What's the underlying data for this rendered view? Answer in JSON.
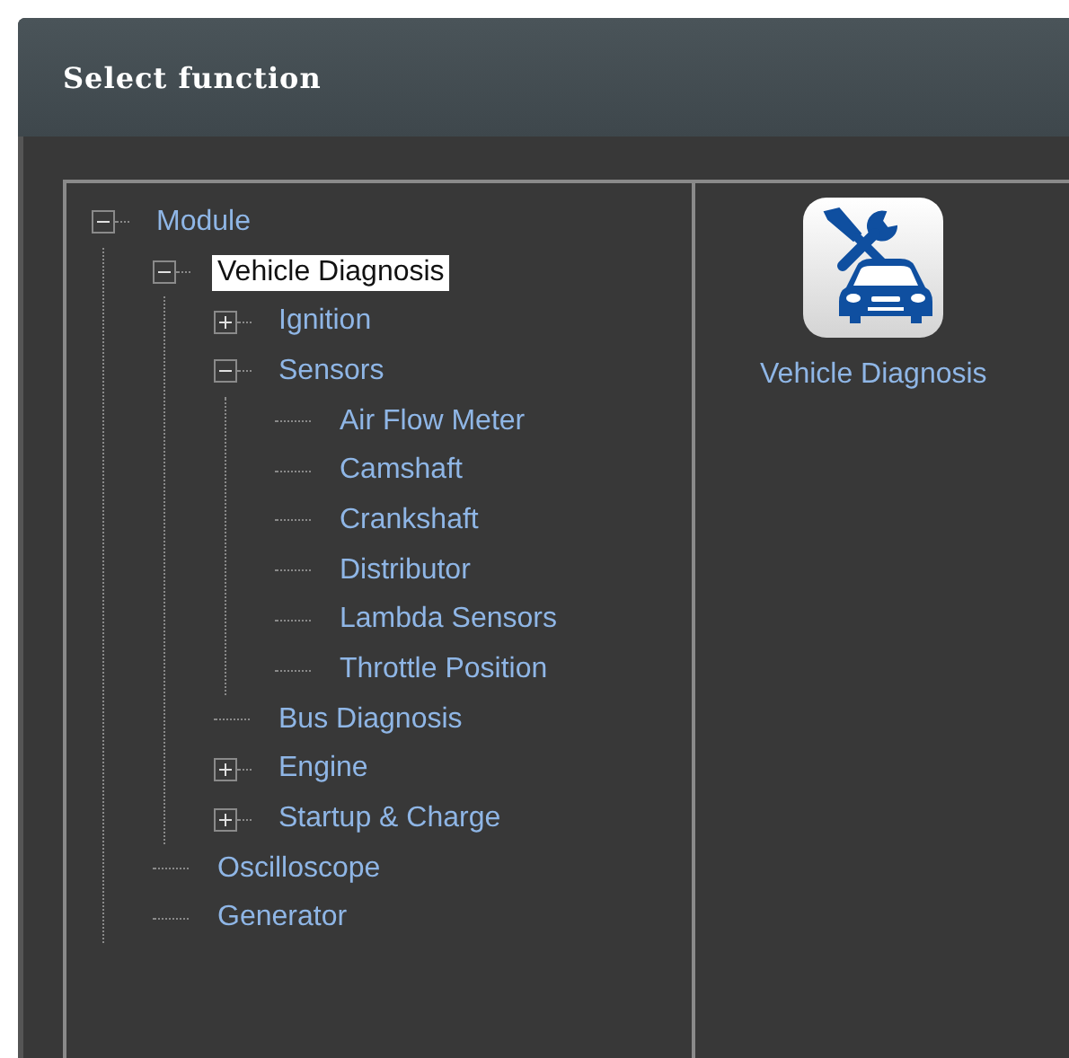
{
  "window": {
    "title": "Select function"
  },
  "tree": [
    {
      "label": "Module",
      "expanded": true,
      "selected": false,
      "children": [
        {
          "label": "Vehicle Diagnosis",
          "expanded": true,
          "selected": true,
          "children": [
            {
              "label": "Ignition",
              "expanded": false,
              "selected": false
            },
            {
              "label": "Sensors",
              "expanded": true,
              "selected": false,
              "children": [
                {
                  "label": "Air Flow Meter",
                  "selected": false
                },
                {
                  "label": "Camshaft",
                  "selected": false
                },
                {
                  "label": "Crankshaft",
                  "selected": false
                },
                {
                  "label": "Distributor",
                  "selected": false
                },
                {
                  "label": "Lambda Sensors",
                  "selected": false
                },
                {
                  "label": "Throttle Position",
                  "selected": false
                }
              ]
            },
            {
              "label": "Bus Diagnosis",
              "selected": false
            },
            {
              "label": "Engine",
              "expanded": false,
              "selected": false
            },
            {
              "label": "Startup & Charge",
              "expanded": false,
              "selected": false
            }
          ]
        },
        {
          "label": "Oscilloscope",
          "selected": false
        },
        {
          "label": "Generator",
          "selected": false
        }
      ]
    }
  ],
  "functions": [
    {
      "label": "Vehicle Diagnosis"
    }
  ]
}
